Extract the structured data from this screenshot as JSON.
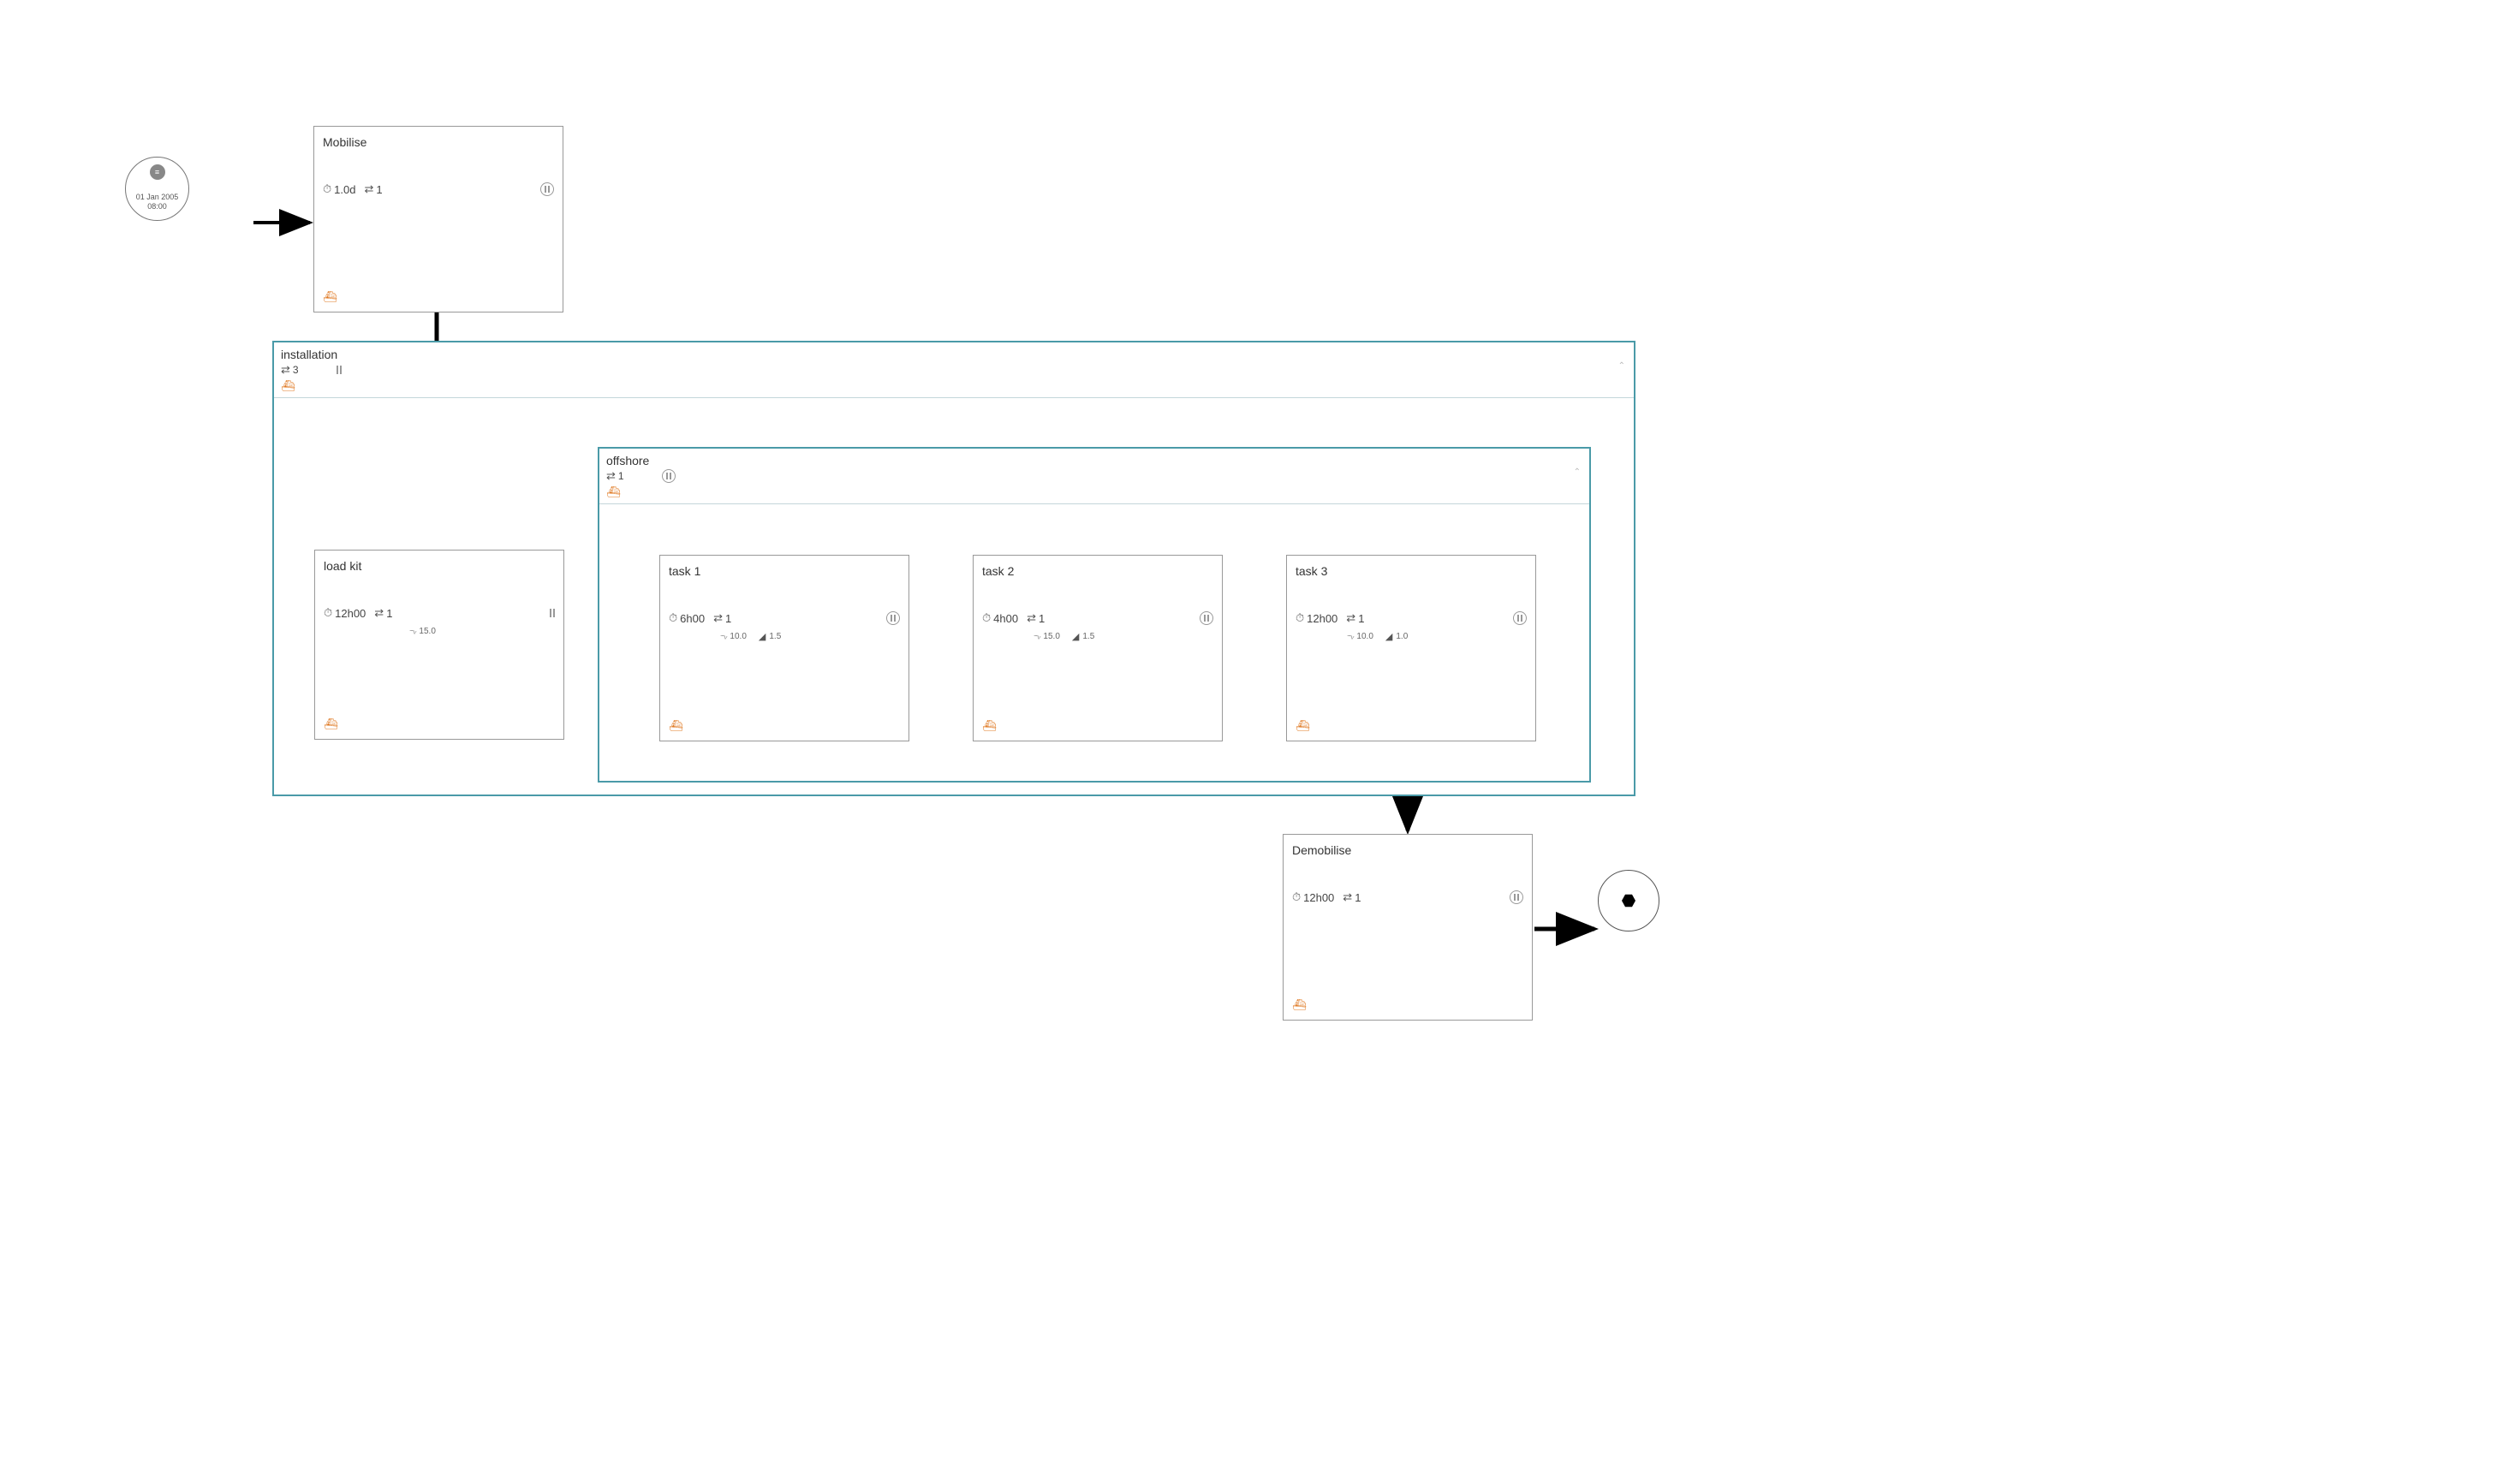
{
  "start": {
    "date": "01 Jan 2005",
    "time": "08:00"
  },
  "mobilise": {
    "title": "Mobilise",
    "duration": "1.0d",
    "cycles": "1"
  },
  "installation_group": {
    "title": "installation",
    "cycles": "3",
    "load_kit": {
      "title": "load kit",
      "duration": "12h00",
      "cycles": "1",
      "wind": "15.0"
    },
    "offshore_group": {
      "title": "offshore",
      "cycles": "1",
      "task1": {
        "title": "task 1",
        "duration": "6h00",
        "cycles": "1",
        "wind": "10.0",
        "wave": "1.5"
      },
      "task2": {
        "title": "task 2",
        "duration": "4h00",
        "cycles": "1",
        "wind": "15.0",
        "wave": "1.5"
      },
      "task3": {
        "title": "task 3",
        "duration": "12h00",
        "cycles": "1",
        "wind": "10.0",
        "wave": "1.0"
      }
    }
  },
  "demobilise": {
    "title": "Demobilise",
    "duration": "12h00",
    "cycles": "1"
  }
}
